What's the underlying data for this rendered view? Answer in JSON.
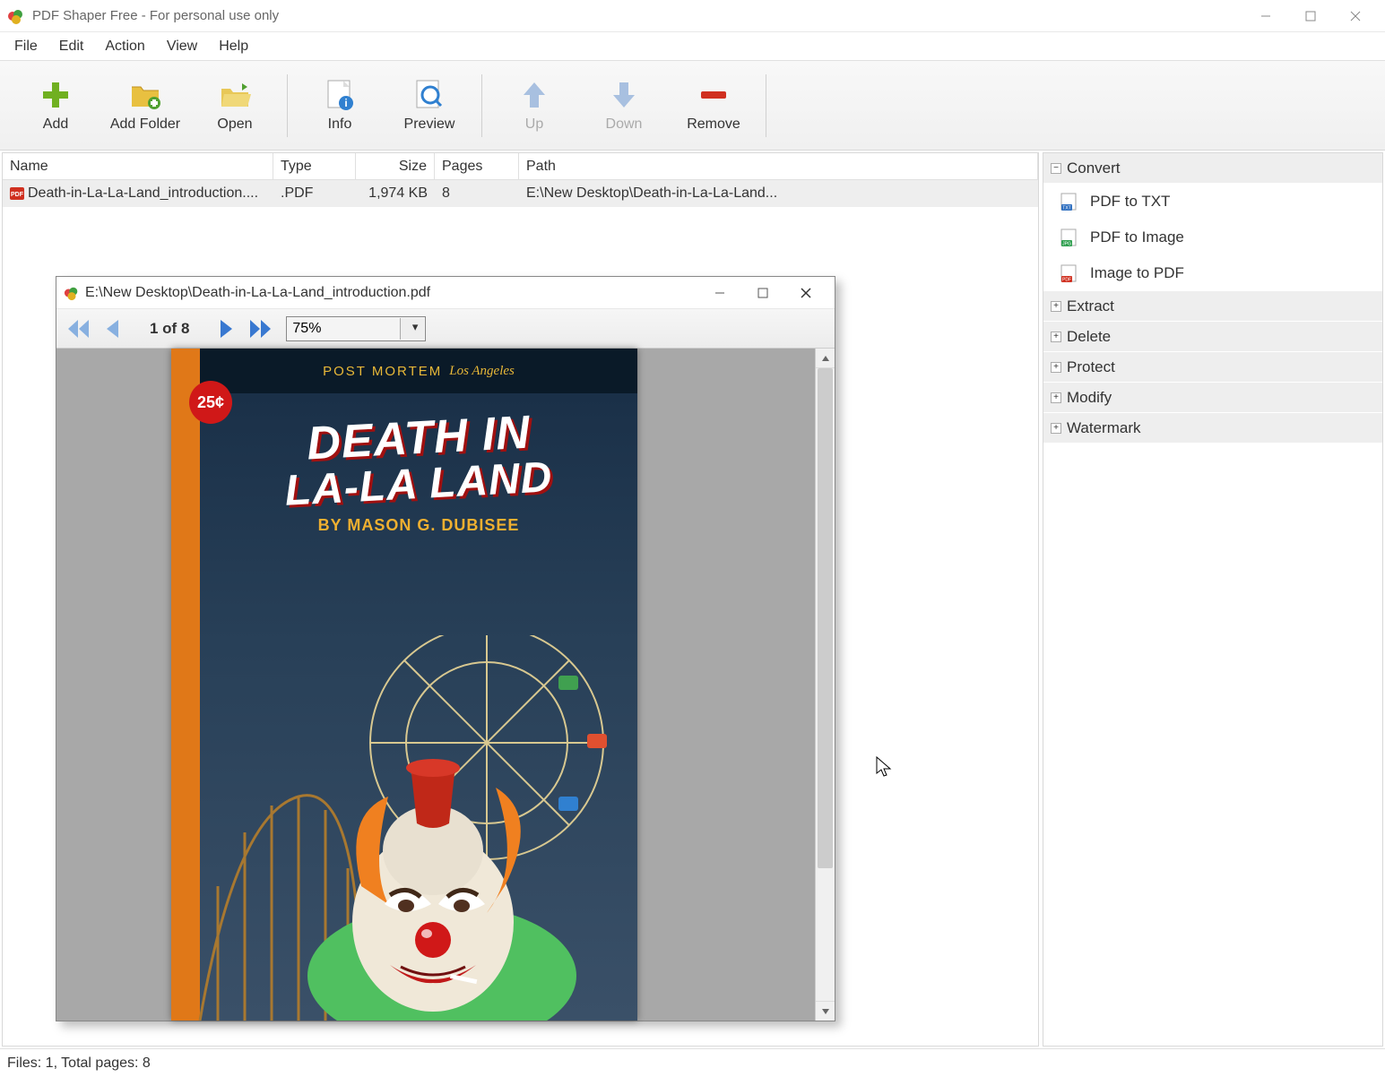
{
  "titlebar": {
    "title": "PDF Shaper Free - For personal use only"
  },
  "menubar": {
    "items": [
      "File",
      "Edit",
      "Action",
      "View",
      "Help"
    ]
  },
  "toolbar": {
    "add": "Add",
    "add_folder": "Add Folder",
    "open": "Open",
    "info": "Info",
    "preview": "Preview",
    "up": "Up",
    "down": "Down",
    "remove": "Remove"
  },
  "file_table": {
    "headers": {
      "name": "Name",
      "type": "Type",
      "size": "Size",
      "pages": "Pages",
      "path": "Path"
    },
    "rows": [
      {
        "name": "Death-in-La-La-Land_introduction....",
        "type": ".PDF",
        "size": "1,974 KB",
        "pages": "8",
        "path": "E:\\New Desktop\\Death-in-La-La-Land..."
      }
    ]
  },
  "side_panel": {
    "groups": {
      "convert": {
        "label": "Convert",
        "expanded": true,
        "items": [
          {
            "label": "PDF to TXT",
            "icon": "txt"
          },
          {
            "label": "PDF to Image",
            "icon": "jpg"
          },
          {
            "label": "Image to PDF",
            "icon": "pdf"
          }
        ]
      },
      "extract": {
        "label": "Extract",
        "expanded": false
      },
      "delete": {
        "label": "Delete",
        "expanded": false
      },
      "protect": {
        "label": "Protect",
        "expanded": false
      },
      "modify": {
        "label": "Modify",
        "expanded": false
      },
      "watermark": {
        "label": "Watermark",
        "expanded": false
      }
    }
  },
  "statusbar": {
    "text": "Files: 1, Total pages: 8"
  },
  "preview_window": {
    "title": "E:\\New Desktop\\Death-in-La-La-Land_introduction.pdf",
    "page_indicator": "1 of 8",
    "zoom": "75%",
    "cover": {
      "publisher": "POST MORTEM",
      "city": "Los Angeles",
      "price": "25¢",
      "title_line1": "DEATH IN",
      "title_line2": "LA-LA LAND",
      "by": "BY",
      "author": "MASON G. DUBISEE"
    }
  }
}
